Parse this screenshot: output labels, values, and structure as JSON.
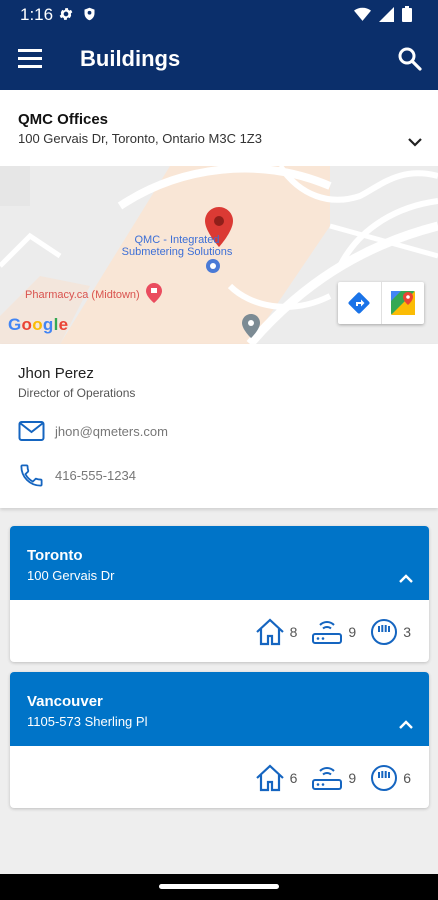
{
  "status_bar": {
    "time": "1:16",
    "left_icons": [
      "gear-icon",
      "shield-icon"
    ],
    "right_icons": [
      "wifi-icon",
      "signal-icon",
      "battery-icon"
    ]
  },
  "app_bar": {
    "title": "Buildings",
    "menu_icon": "menu-icon",
    "search_icon": "search-icon"
  },
  "building_selector": {
    "name": "QMC Offices",
    "address": "100 Gervais Dr, Toronto, Ontario M3C 1Z3"
  },
  "map": {
    "poi_label": "QMC - Integrated Submetering Solutions",
    "pharmacy_label": "Pharmacy.ca (Midtown)",
    "google_logo": "Google",
    "buttons": [
      "directions-icon",
      "google-maps-icon"
    ],
    "colors": {
      "accent": "#0b2f6b",
      "pin": "#db3a34"
    }
  },
  "contact": {
    "name": "Jhon Perez",
    "title": "Director of Operations",
    "email": "jhon@qmeters.com",
    "phone": "416-555-1234"
  },
  "locations": [
    {
      "city": "Toronto",
      "address": "100 Gervais Dr",
      "buildings": "8",
      "gateways": "9",
      "meters": "3"
    },
    {
      "city": "Vancouver",
      "address": "1105-573 Sherling Pl",
      "buildings": "6",
      "gateways": "9",
      "meters": "6"
    }
  ],
  "colors": {
    "header": "#0b2f6b",
    "card_header": "#0074c8",
    "icon_blue": "#1565c0"
  }
}
